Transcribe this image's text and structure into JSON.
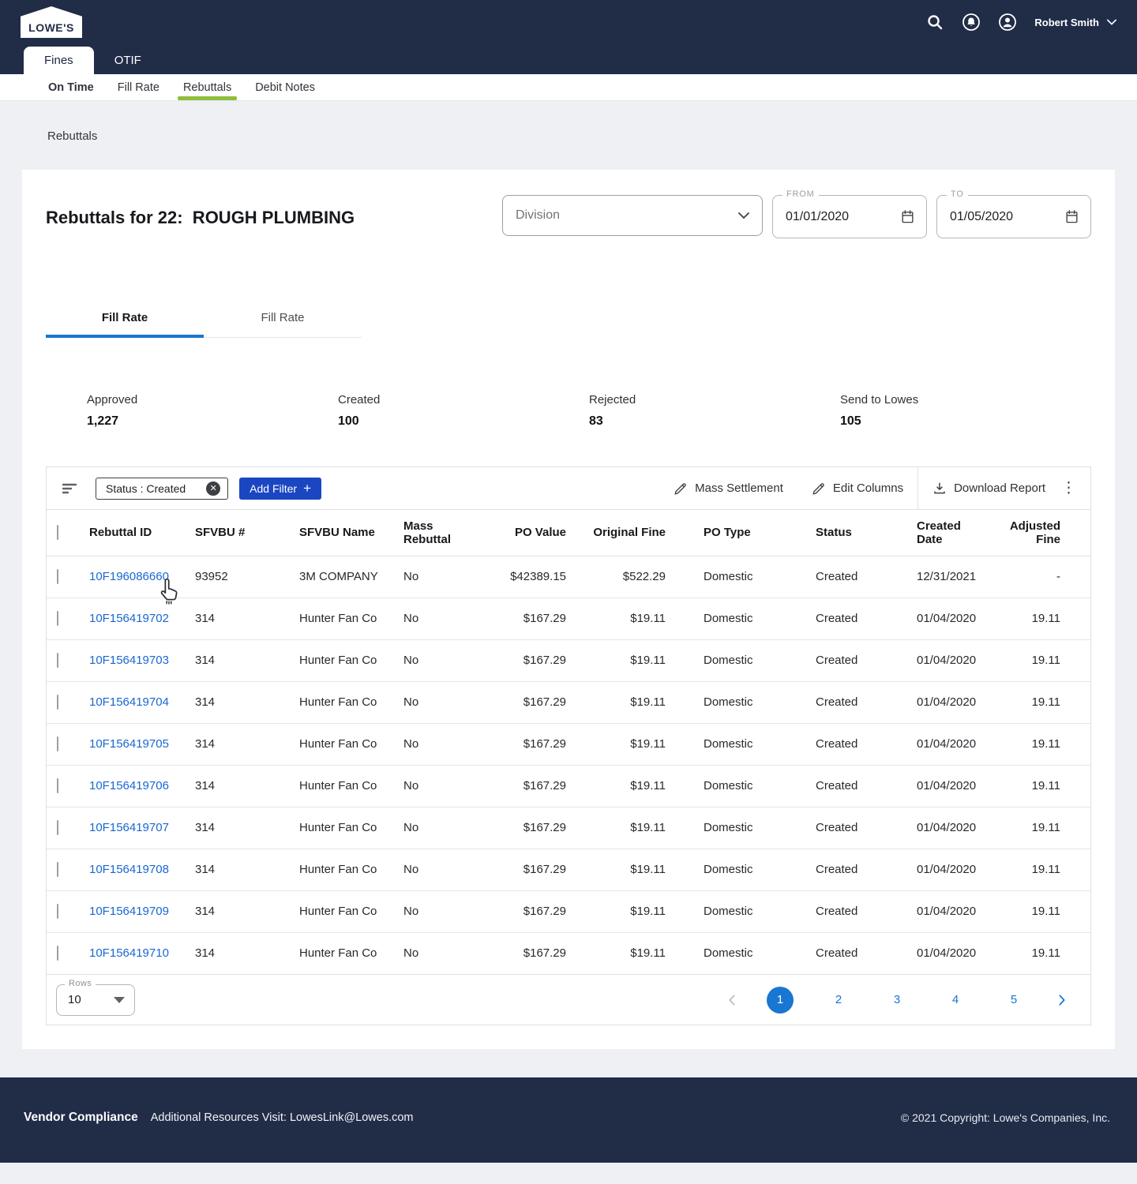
{
  "brand": {
    "logo_text": "LOWE'S"
  },
  "header": {
    "user_name": "Robert Smith"
  },
  "nav": {
    "primary_tabs": [
      {
        "label": "Fines",
        "active": true
      },
      {
        "label": "OTIF",
        "active": false
      }
    ],
    "sub_tabs": [
      {
        "label": "On Time",
        "active": false
      },
      {
        "label": "Fill Rate",
        "active": false
      },
      {
        "label": "Rebuttals",
        "active": true
      },
      {
        "label": "Debit Notes",
        "active": false
      }
    ]
  },
  "breadcrumb": "Rebuttals",
  "main": {
    "title": "Rebuttals for 22:  ROUGH PLUMBING",
    "filters": {
      "division_placeholder": "Division",
      "from_label": "FROM",
      "from_value": "01/01/2020",
      "to_label": "TO",
      "to_value": "01/05/2020"
    },
    "tabs": [
      {
        "label": "Fill Rate",
        "active": true
      },
      {
        "label": "Fill Rate",
        "active": false
      }
    ],
    "stats": [
      {
        "label": "Approved",
        "value": "1,227"
      },
      {
        "label": "Created",
        "value": "100"
      },
      {
        "label": "Rejected",
        "value": "83"
      },
      {
        "label": "Send to Lowes",
        "value": "105"
      }
    ]
  },
  "toolbar": {
    "filter_chip": "Status : Created",
    "add_filter_label": "Add Filter",
    "mass_settlement_label": "Mass Settlement",
    "edit_columns_label": "Edit Columns",
    "download_report_label": "Download Report"
  },
  "table": {
    "headers": [
      "Rebuttal ID",
      "SFVBU #",
      "SFVBU Name",
      "Mass Rebuttal",
      "PO Value",
      "Original Fine",
      "PO Type",
      "Status",
      "Created Date",
      "Adjusted Fine"
    ],
    "rows": [
      {
        "rebuttal_id": "10F196086660",
        "sfvbu": "93952",
        "sfvbu_name": "3M COMPANY",
        "mass_rebuttal": "No",
        "po_value": "$42389.15",
        "original_fine": "$522.29",
        "po_type": "Domestic",
        "status": "Created",
        "created_date": "12/31/2021",
        "adjusted_fine": "-"
      },
      {
        "rebuttal_id": "10F156419702",
        "sfvbu": "314",
        "sfvbu_name": "Hunter Fan Co",
        "mass_rebuttal": "No",
        "po_value": "$167.29",
        "original_fine": "$19.11",
        "po_type": "Domestic",
        "status": "Created",
        "created_date": "01/04/2020",
        "adjusted_fine": "19.11"
      },
      {
        "rebuttal_id": "10F156419703",
        "sfvbu": "314",
        "sfvbu_name": "Hunter Fan Co",
        "mass_rebuttal": "No",
        "po_value": "$167.29",
        "original_fine": "$19.11",
        "po_type": "Domestic",
        "status": "Created",
        "created_date": "01/04/2020",
        "adjusted_fine": "19.11"
      },
      {
        "rebuttal_id": "10F156419704",
        "sfvbu": "314",
        "sfvbu_name": "Hunter Fan Co",
        "mass_rebuttal": "No",
        "po_value": "$167.29",
        "original_fine": "$19.11",
        "po_type": "Domestic",
        "status": "Created",
        "created_date": "01/04/2020",
        "adjusted_fine": "19.11"
      },
      {
        "rebuttal_id": "10F156419705",
        "sfvbu": "314",
        "sfvbu_name": "Hunter Fan Co",
        "mass_rebuttal": "No",
        "po_value": "$167.29",
        "original_fine": "$19.11",
        "po_type": "Domestic",
        "status": "Created",
        "created_date": "01/04/2020",
        "adjusted_fine": "19.11"
      },
      {
        "rebuttal_id": "10F156419706",
        "sfvbu": "314",
        "sfvbu_name": "Hunter Fan Co",
        "mass_rebuttal": "No",
        "po_value": "$167.29",
        "original_fine": "$19.11",
        "po_type": "Domestic",
        "status": "Created",
        "created_date": "01/04/2020",
        "adjusted_fine": "19.11"
      },
      {
        "rebuttal_id": "10F156419707",
        "sfvbu": "314",
        "sfvbu_name": "Hunter Fan Co",
        "mass_rebuttal": "No",
        "po_value": "$167.29",
        "original_fine": "$19.11",
        "po_type": "Domestic",
        "status": "Created",
        "created_date": "01/04/2020",
        "adjusted_fine": "19.11"
      },
      {
        "rebuttal_id": "10F156419708",
        "sfvbu": "314",
        "sfvbu_name": "Hunter Fan Co",
        "mass_rebuttal": "No",
        "po_value": "$167.29",
        "original_fine": "$19.11",
        "po_type": "Domestic",
        "status": "Created",
        "created_date": "01/04/2020",
        "adjusted_fine": "19.11"
      },
      {
        "rebuttal_id": "10F156419709",
        "sfvbu": "314",
        "sfvbu_name": "Hunter Fan Co",
        "mass_rebuttal": "No",
        "po_value": "$167.29",
        "original_fine": "$19.11",
        "po_type": "Domestic",
        "status": "Created",
        "created_date": "01/04/2020",
        "adjusted_fine": "19.11"
      },
      {
        "rebuttal_id": "10F156419710",
        "sfvbu": "314",
        "sfvbu_name": "Hunter Fan Co",
        "mass_rebuttal": "No",
        "po_value": "$167.29",
        "original_fine": "$19.11",
        "po_type": "Domestic",
        "status": "Created",
        "created_date": "01/04/2020",
        "adjusted_fine": "19.11"
      }
    ]
  },
  "pagination": {
    "rows_label": "Rows",
    "rows_per_page": "10",
    "pages": [
      "1",
      "2",
      "3",
      "4",
      "5"
    ],
    "active_page": "1"
  },
  "footer": {
    "title": "Vendor Compliance",
    "resources": "Additional Resources Visit: LowesLink@Lowes.com",
    "copyright": "© 2021 Copyright: Lowe's Companies, Inc."
  },
  "colors": {
    "navy": "#212c47",
    "accent_green": "#8fbe3c",
    "link_blue": "#1967d2",
    "button_blue": "#1b46c2"
  }
}
